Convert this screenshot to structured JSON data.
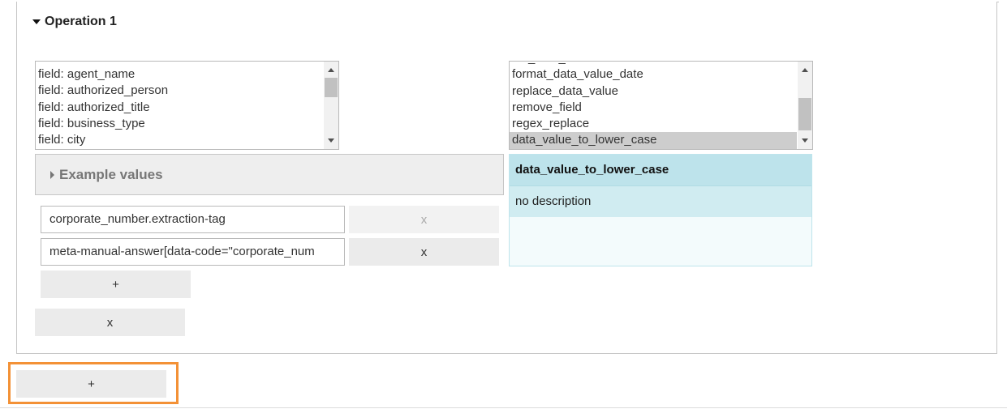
{
  "operation": {
    "title": "Operation 1"
  },
  "field_list": {
    "items": [
      "field: agent_name",
      "field: authorized_person",
      "field: authorized_title",
      "field: business_type",
      "field: city"
    ],
    "scroll_fraction": 0.02
  },
  "function_list": {
    "items": [
      "set_data_value",
      "format_data_value_date",
      "replace_data_value",
      "remove_field",
      "regex_replace",
      "data_value_to_lower_case"
    ],
    "selected": "data_value_to_lower_case"
  },
  "example_values": {
    "label": "Example values"
  },
  "selectors": [
    {
      "value": "corporate_number.extraction-tag",
      "remove_label": "x",
      "remove_disabled": true
    },
    {
      "value": "meta-manual-answer[data-code=\"corporate_num",
      "remove_label": "x",
      "remove_disabled": false
    }
  ],
  "buttons": {
    "add_selector": "+",
    "remove_operation": "x",
    "add_operation": "+"
  },
  "info": {
    "title": "data_value_to_lower_case",
    "description": "no description"
  },
  "colors": {
    "highlight": "#f39136",
    "info_header": "#bde3eb",
    "info_desc": "#d0ecf1"
  }
}
